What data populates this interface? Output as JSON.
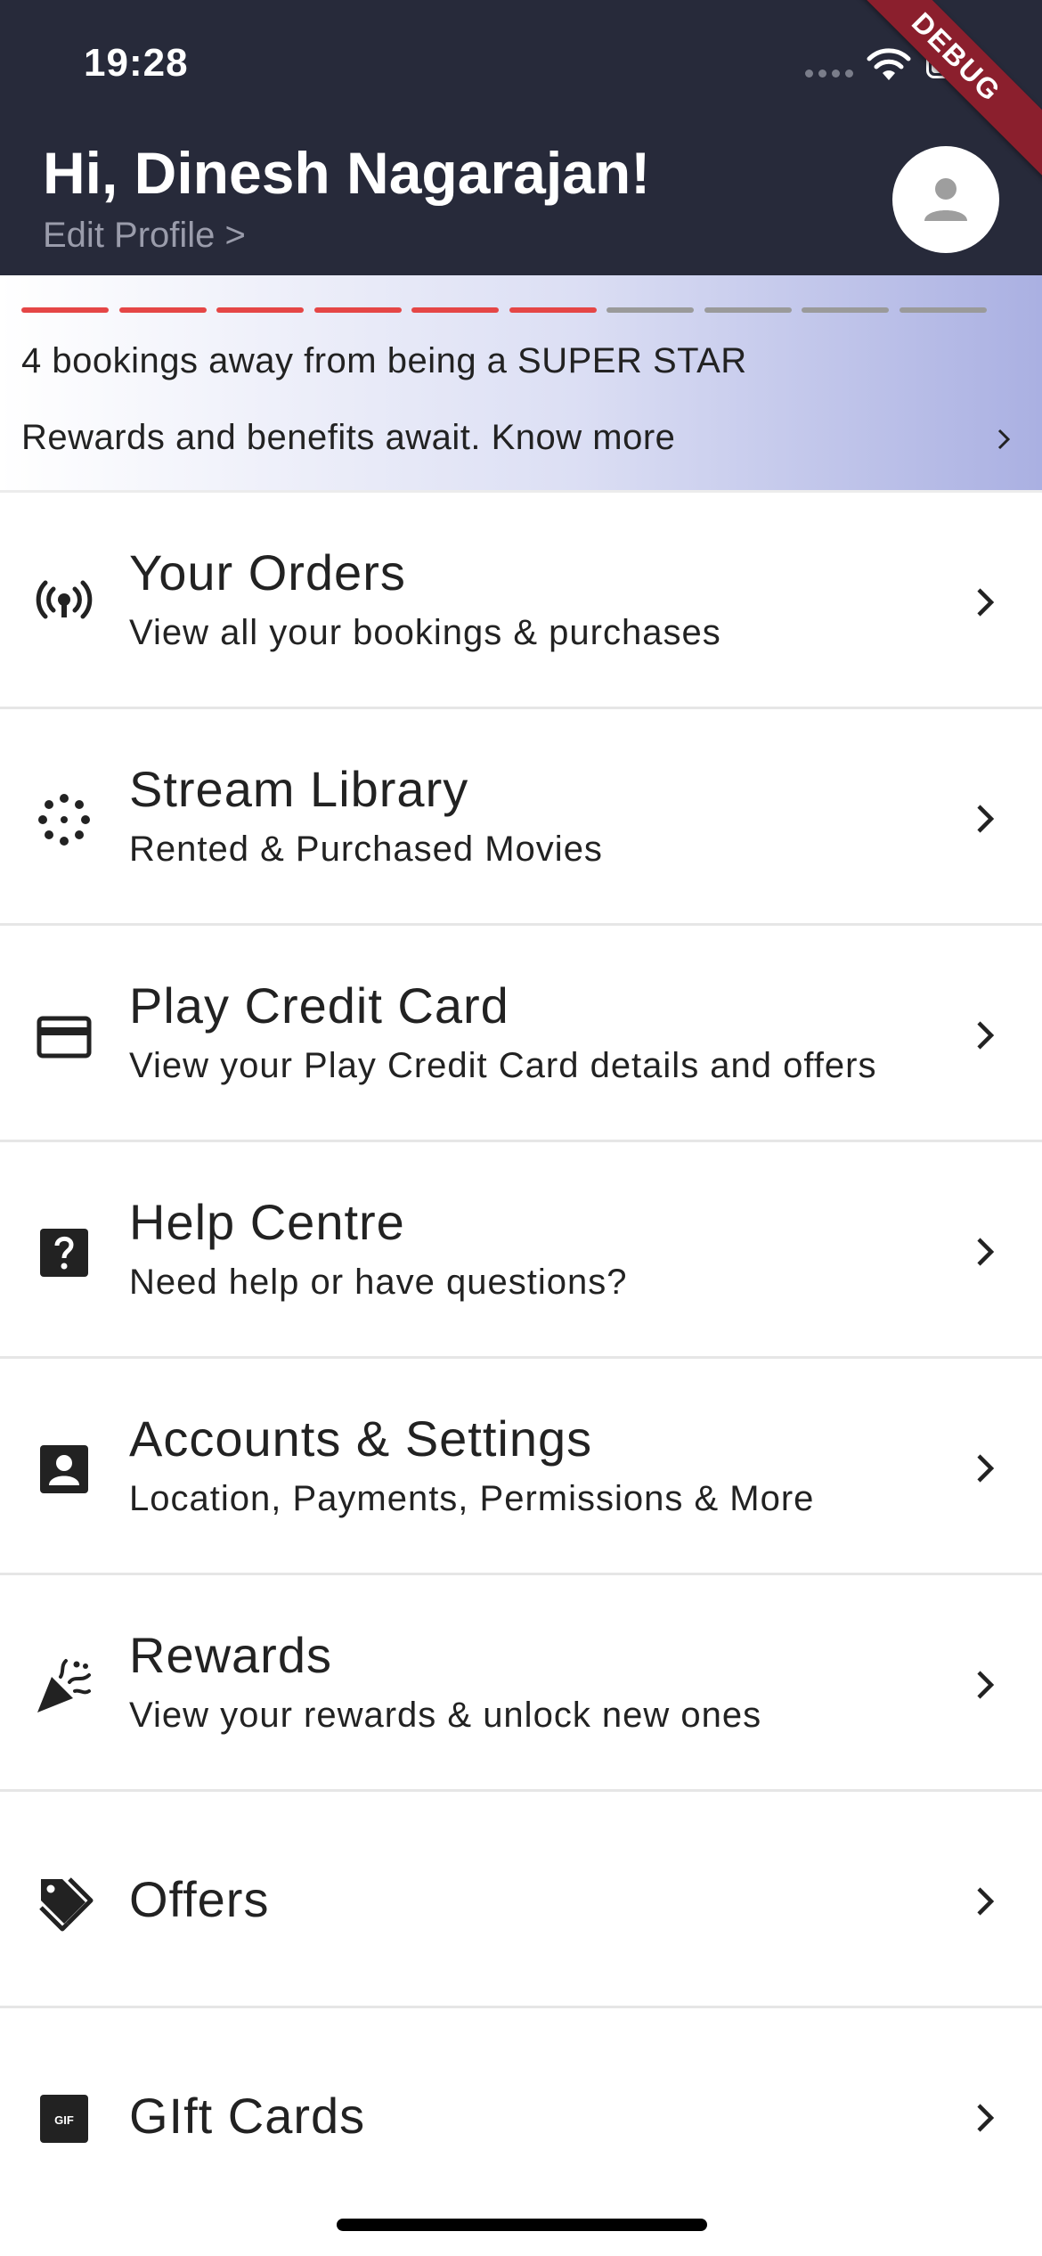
{
  "status_bar": {
    "time": "19:28"
  },
  "debug_label": "DEBUG",
  "header": {
    "greeting": "Hi, Dinesh Nagarajan!",
    "edit_profile": "Edit Profile >"
  },
  "rewards_banner": {
    "progress_completed": 6,
    "progress_total": 10,
    "line1": "4 bookings away from being a SUPER STAR",
    "line2": "Rewards and benefits await. Know more"
  },
  "menu": [
    {
      "icon": "broadcast-icon",
      "title": "Your Orders",
      "subtitle": "View all your bookings & purchases"
    },
    {
      "icon": "scatter-dots-icon",
      "title": "Stream Library",
      "subtitle": "Rented & Purchased Movies"
    },
    {
      "icon": "credit-card-icon",
      "title": "Play Credit Card",
      "subtitle": "View your Play Credit Card details and offers"
    },
    {
      "icon": "help-icon",
      "title": "Help Centre",
      "subtitle": "Need help or have questions?"
    },
    {
      "icon": "account-box-icon",
      "title": "Accounts & Settings",
      "subtitle": "Location, Payments, Permissions & More"
    },
    {
      "icon": "celebration-icon",
      "title": "Rewards",
      "subtitle": "View your rewards & unlock new ones"
    },
    {
      "icon": "tags-icon",
      "title": "Offers",
      "subtitle": ""
    },
    {
      "icon": "gif-icon",
      "title": "GIft Cards",
      "subtitle": "",
      "icon_text": "GIF"
    }
  ],
  "colors": {
    "header_bg": "#272a3a",
    "progress_on": "#e54646",
    "progress_off": "#9a9a9a",
    "banner_gradient_end": "#aab0e2",
    "ribbon": "#8b1f2d"
  }
}
